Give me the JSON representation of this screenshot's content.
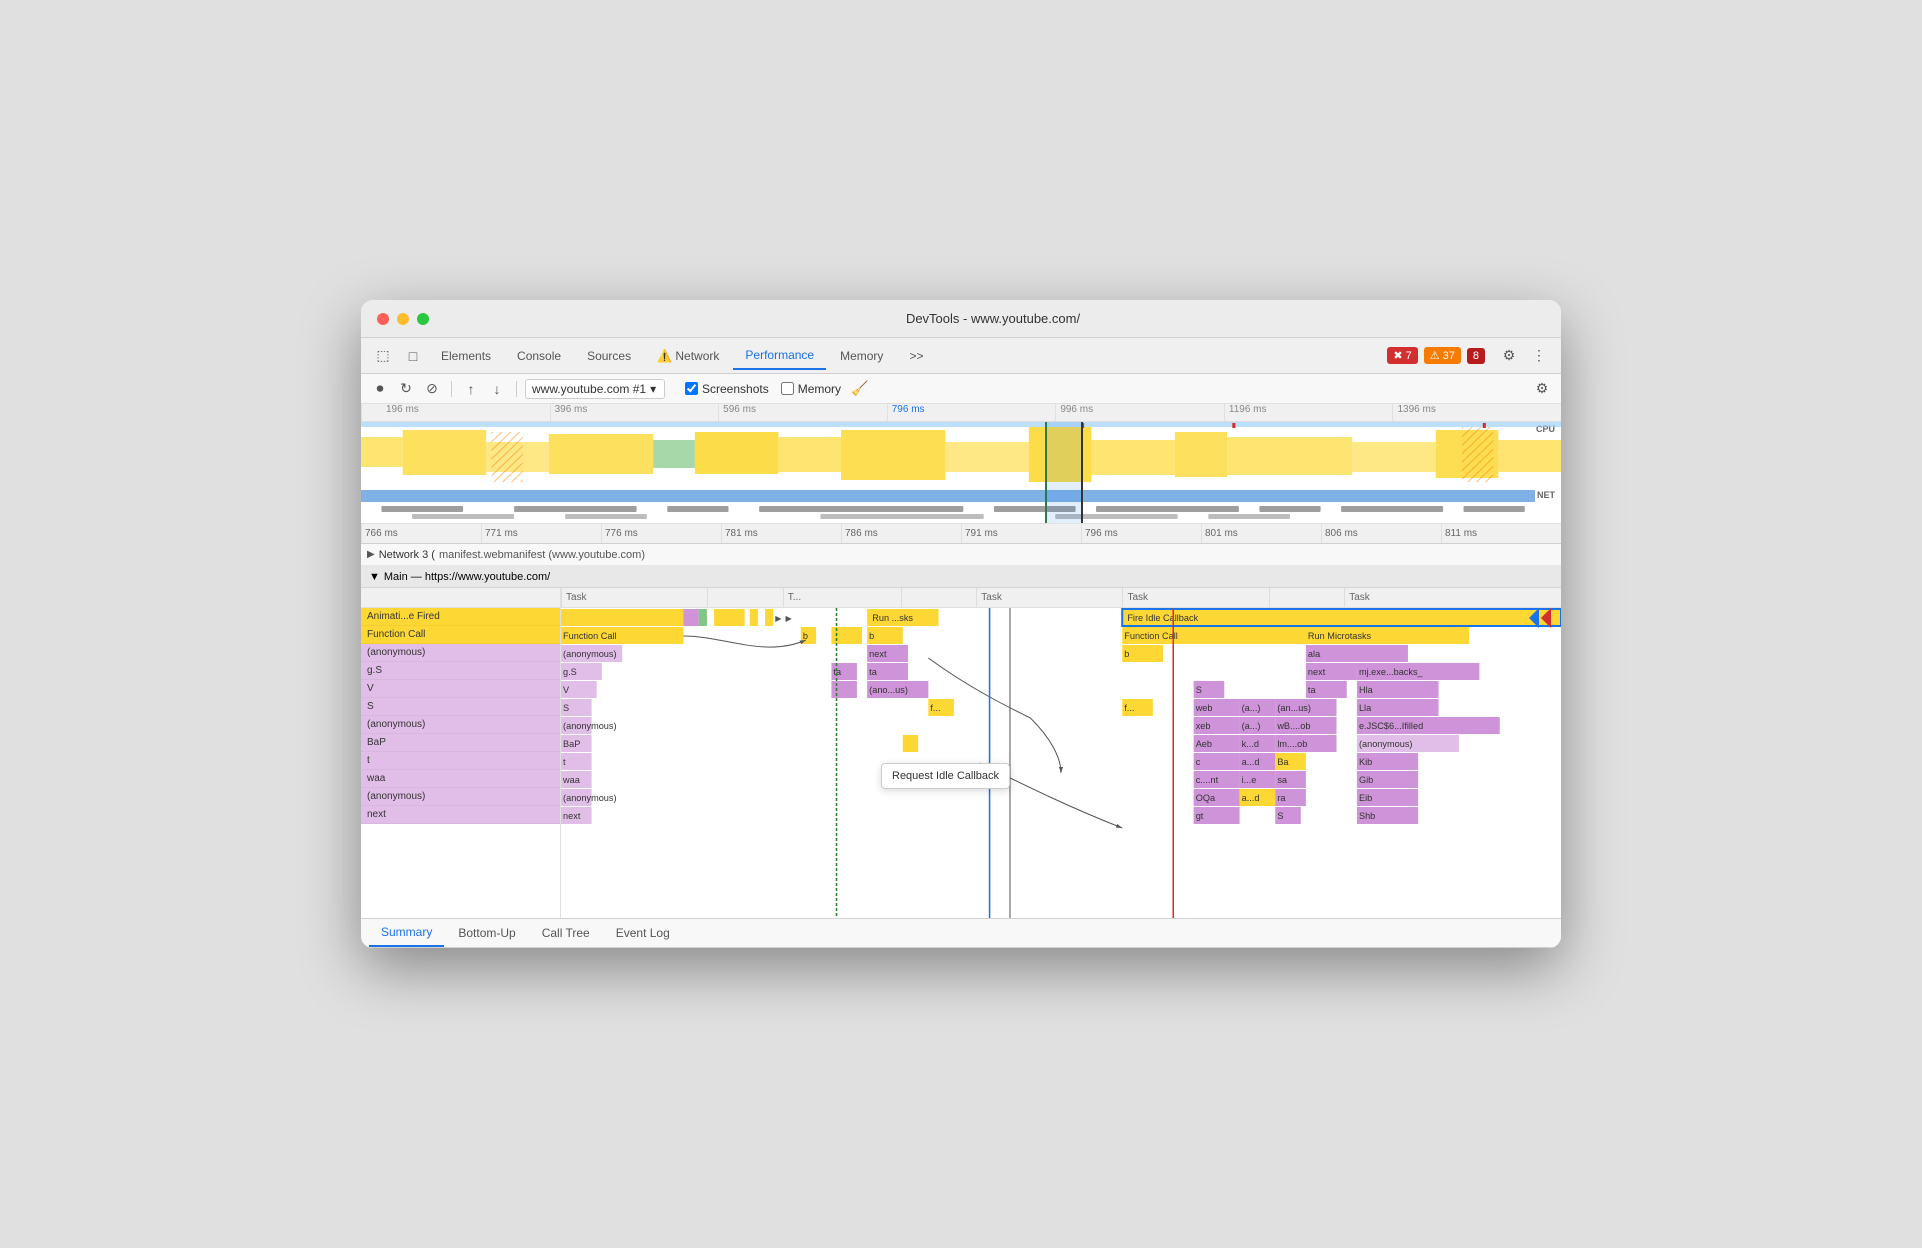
{
  "window": {
    "title": "DevTools - www.youtube.com/"
  },
  "tabs": {
    "items": [
      {
        "label": "Elements",
        "active": false
      },
      {
        "label": "Console",
        "active": false
      },
      {
        "label": "Sources",
        "active": false
      },
      {
        "label": "Network",
        "active": false,
        "warning": true
      },
      {
        "label": "Performance",
        "active": true
      },
      {
        "label": "Memory",
        "active": false
      }
    ],
    "more": ">>",
    "error_badge": "7",
    "warn_badge": "37",
    "info_badge": "8"
  },
  "toolbar": {
    "url": "www.youtube.com #1",
    "screenshots_label": "Screenshots",
    "memory_label": "Memory"
  },
  "timeline": {
    "ruler_marks": [
      "196 ms",
      "396 ms",
      "596 ms",
      "796 ms",
      "996 ms",
      "1196 ms",
      "1396 ms"
    ],
    "zoomed_marks": [
      "766 ms",
      "771 ms",
      "776 ms",
      "781 ms",
      "786 ms",
      "791 ms",
      "796 ms",
      "801 ms",
      "806 ms",
      "811 ms"
    ]
  },
  "network_row": {
    "label": "Network 3 (",
    "manifest": "manifest.webmanifest (www.youtube.com)"
  },
  "main_section": {
    "label": "▼ Main — https://www.youtube.com/"
  },
  "flame_columns": [
    "Task",
    "",
    "T...",
    "",
    "Task",
    "Task",
    "",
    "Task"
  ],
  "flame_rows": [
    {
      "label": "Animati...e Fired",
      "cells": [
        {
          "text": "",
          "color": "yellow",
          "width": "14%"
        },
        {
          "text": "",
          "color": "purple",
          "width": "2%"
        },
        {
          "text": "",
          "color": "yellow",
          "width": "4%"
        },
        {
          "text": "Run ...sks",
          "color": "yellow",
          "width": "8%"
        },
        {
          "text": "Fire Idle Callback",
          "color": "yellow",
          "width": "20%"
        }
      ]
    },
    {
      "label": "Function Call",
      "cells": [
        {
          "text": "b",
          "color": "yellow",
          "width": "4%"
        },
        {
          "text": "b",
          "color": "yellow",
          "width": "8%"
        },
        {
          "text": "Function Call",
          "color": "yellow",
          "width": "10%"
        },
        {
          "text": "Run Microtasks",
          "color": "yellow",
          "width": "10%"
        }
      ]
    },
    {
      "label": "(anonymous)",
      "cells": [
        {
          "text": "next",
          "color": "purple",
          "width": "8%"
        },
        {
          "text": "b",
          "color": "yellow",
          "width": "5%"
        },
        {
          "text": "ala",
          "color": "purple",
          "width": "8%"
        }
      ]
    },
    {
      "label": "g.S",
      "cells": [
        {
          "text": "ta",
          "color": "purple",
          "width": "4%"
        },
        {
          "text": "ta",
          "color": "purple",
          "width": "8%"
        },
        {
          "text": "next",
          "color": "purple",
          "width": "5%"
        },
        {
          "text": "mj.exe...backs_",
          "color": "purple",
          "width": "10%"
        }
      ]
    },
    {
      "label": "V",
      "cells": [
        {
          "text": "(ano...us)",
          "color": "purple",
          "width": "8%"
        },
        {
          "text": "S",
          "color": "purple",
          "width": "3%"
        },
        {
          "text": "ta",
          "color": "purple",
          "width": "5%"
        },
        {
          "text": "Hla",
          "color": "purple",
          "width": "8%"
        }
      ]
    },
    {
      "label": "S",
      "cells": [
        {
          "text": "f...",
          "color": "yellow",
          "width": "3%"
        },
        {
          "text": "web",
          "color": "purple",
          "width": "5%"
        },
        {
          "text": "(a...)",
          "color": "purple",
          "width": "4%"
        },
        {
          "text": "(an...us)",
          "color": "purple",
          "width": "6%"
        },
        {
          "text": "Lla",
          "color": "purple",
          "width": "8%"
        }
      ]
    },
    {
      "label": "(anonymous)",
      "cells": [
        {
          "text": "xeb",
          "color": "purple",
          "width": "5%"
        },
        {
          "text": "(a...)",
          "color": "purple",
          "width": "4%"
        },
        {
          "text": "wB....ob",
          "color": "purple",
          "width": "6%"
        },
        {
          "text": "e.JSC$6...Ifilled",
          "color": "purple",
          "width": "10%"
        }
      ]
    },
    {
      "label": "BaP",
      "cells": [
        {
          "text": "Aeb",
          "color": "purple",
          "width": "5%"
        },
        {
          "text": "k...d",
          "color": "purple",
          "width": "4%"
        },
        {
          "text": "lm....ob",
          "color": "purple",
          "width": "6%"
        },
        {
          "text": "(anonymous)",
          "color": "purple",
          "width": "10%"
        }
      ]
    },
    {
      "label": "t",
      "cells": [
        {
          "text": "c",
          "color": "purple",
          "width": "5%"
        },
        {
          "text": "a...d",
          "color": "purple",
          "width": "4%"
        },
        {
          "text": "Ba",
          "color": "yellow",
          "width": "3%"
        },
        {
          "text": "Kib",
          "color": "purple",
          "width": "6%"
        }
      ]
    },
    {
      "label": "waa",
      "cells": [
        {
          "text": "c....nt",
          "color": "purple",
          "width": "5%"
        },
        {
          "text": "i...e",
          "color": "purple",
          "width": "4%"
        },
        {
          "text": "sa",
          "color": "purple",
          "width": "3%"
        },
        {
          "text": "Gib",
          "color": "purple",
          "width": "6%"
        }
      ]
    },
    {
      "label": "(anonymous)",
      "cells": [
        {
          "text": "OQa",
          "color": "purple",
          "width": "5%"
        },
        {
          "text": "a...d",
          "color": "yellow",
          "width": "4%"
        },
        {
          "text": "ra",
          "color": "purple",
          "width": "3%"
        },
        {
          "text": "Eib",
          "color": "purple",
          "width": "6%"
        }
      ]
    },
    {
      "label": "next",
      "cells": [
        {
          "text": "gt",
          "color": "purple",
          "width": "5%"
        },
        {
          "text": "S",
          "color": "purple",
          "width": "3%"
        },
        {
          "text": "Shb",
          "color": "purple",
          "width": "6%"
        }
      ]
    }
  ],
  "tooltip": {
    "text": "Request Idle Callback"
  },
  "bottom_tabs": [
    {
      "label": "Summary",
      "active": true
    },
    {
      "label": "Bottom-Up",
      "active": false
    },
    {
      "label": "Call Tree",
      "active": false
    },
    {
      "label": "Event Log",
      "active": false
    }
  ],
  "icons": {
    "record": "⏺",
    "reload": "↻",
    "clear": "⊘",
    "upload": "↑",
    "download": "↓",
    "settings": "⚙",
    "more": "⋮",
    "broom": "🧹",
    "cursor": "⬚",
    "inspect": "□",
    "expand": "▶",
    "collapse": "▼",
    "chevron_down": "▾"
  }
}
